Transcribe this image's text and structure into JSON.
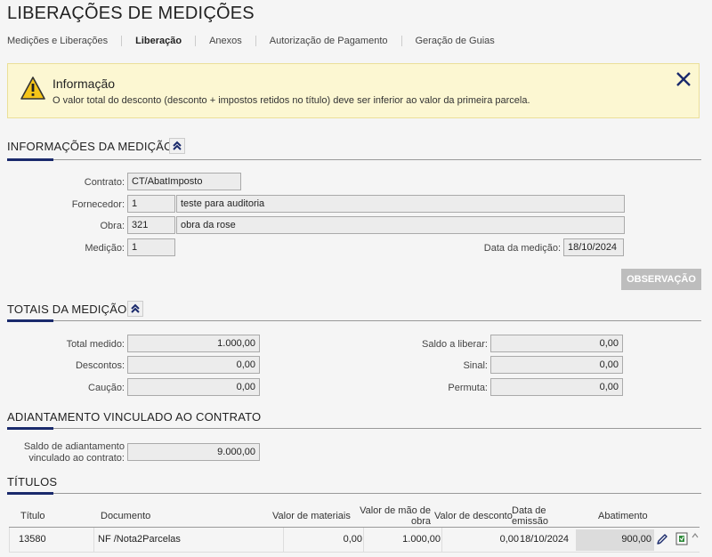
{
  "page": {
    "title": "LIBERAÇÕES DE MEDIÇÕES"
  },
  "tabs": [
    {
      "label": "Medições e Liberações",
      "active": false
    },
    {
      "label": "Liberação",
      "active": true
    },
    {
      "label": "Anexos",
      "active": false
    },
    {
      "label": "Autorização de Pagamento",
      "active": false
    },
    {
      "label": "Geração de Guias",
      "active": false
    }
  ],
  "info": {
    "title": "Informação",
    "text": "O valor total do desconto (desconto + impostos retidos no título) deve ser inferior ao valor da primeira parcela."
  },
  "medicao": {
    "section_title": "INFORMAÇÕES DA MEDIÇÃO",
    "contrato_label": "Contrato:",
    "contrato_value": "CT/AbatImposto",
    "fornecedor_label": "Fornecedor:",
    "fornecedor_code": "1",
    "fornecedor_name": "teste para auditoria",
    "obra_label": "Obra:",
    "obra_code": "321",
    "obra_name": "obra da rose",
    "medicao_label": "Medição:",
    "medicao_value": "1",
    "data_label": "Data da medição:",
    "data_value": "18/10/2024",
    "observacao_button": "OBSERVAÇÃO"
  },
  "totais": {
    "section_title": "TOTAIS DA MEDIÇÃO",
    "total_medido_label": "Total medido:",
    "total_medido": "1.000,00",
    "descontos_label": "Descontos:",
    "descontos": "0,00",
    "caucao_label": "Caução:",
    "caucao": "0,00",
    "saldo_liberar_label": "Saldo a liberar:",
    "saldo_liberar": "0,00",
    "sinal_label": "Sinal:",
    "sinal": "0,00",
    "permuta_label": "Permuta:",
    "permuta": "0,00"
  },
  "adiantamento": {
    "section_title": "ADIANTAMENTO VINCULADO AO CONTRATO",
    "saldo_label_1": "Saldo de adiantamento",
    "saldo_label_2": "vinculado ao contrato:",
    "saldo_value": "9.000,00"
  },
  "titulos": {
    "section_title": "TÍTULOS",
    "headers": {
      "titulo": "Título",
      "documento": "Documento",
      "valor_materiais": "Valor de materiais",
      "valor_mao_obra_1": "Valor de mão de",
      "valor_mao_obra_2": "obra",
      "valor_desconto": "Valor de desconto",
      "data_emissao_1": "Data de",
      "data_emissao_2": "emissão",
      "abatimento": "Abatimento"
    },
    "rows": [
      {
        "titulo": "13580",
        "documento": "NF /Nota2Parcelas",
        "valor_materiais": "0,00",
        "valor_mao_obra": "1.000,00",
        "valor_desconto": "0,00",
        "data_emissao": "18/10/2024",
        "abatimento": "900,00"
      }
    ]
  },
  "icons": {
    "warning": "warning-icon",
    "close": "close-icon",
    "collapse": "chevron-double-up-icon",
    "edit": "pencil-icon",
    "document": "document-icon",
    "scroll_up": "scroll-up-icon"
  },
  "colors": {
    "accent": "#1a2a6c",
    "info_bg": "#fcf7d2",
    "button_disabled": "#bdbdbd"
  }
}
